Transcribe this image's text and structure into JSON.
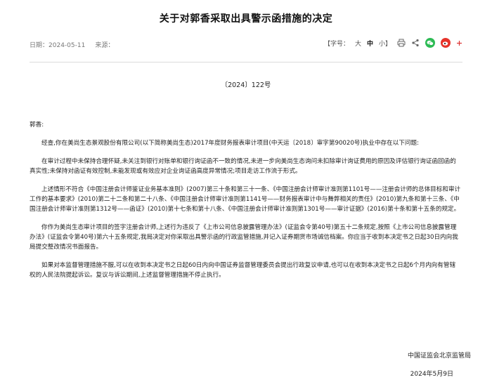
{
  "article": {
    "title": "关于对郭香采取出具警示函措施的决定",
    "date_label": "日期：",
    "date": "2024-05-11",
    "source_label": "来源：",
    "doc_number": "〔2024〕122号",
    "greeting": "郭香:",
    "paragraphs": [
      "经查,你在美尚生态景观股份有限公司(以下简称美尚生态)2017年度财务报表审计项目(中天运〔2018〕审字第90020号)执业中存在以下问题:",
      "在审计过程中未保持合理怀疑,未关注到银行对账单和银行询证函不一致的情况,未进一步向美尚生态询问未扣除审计询证费用的原因及评估银行询证函回函的真实性;未保持对函证有效控制,未能发现或有效应对企业询证函高度异常情况;项目走访工作流于形式。",
      "上述情形不符合《中国注册会计师鉴证业务基本准则》(2007)第三十条和第三十一条、《中国注册会计师审计准则第1101号——注册会计师的总体目标和审计工作的基本要求》(2010)第二十二条和第二十八条、《中国注册会计师审计准则第1141号——财务报表审计中与舞弊相关的责任》(2010)第九条和第十三条、《中国注册会计师审计准则第1312号——函证》(2010)第十七条和第十八条、《中国注册会计师审计准则第1301号——审计证据》(2016)第十条和第十五条的规定。",
      "你作为美尚生态审计项目的签字注册会计师,上述行为违反了《上市公司信息披露管理办法》(证监会令第40号)第五十二条规定,按照《上市公司信息披露管理办法》(证监会令第40号)第六十五条规定,我局决定对你采取出具警示函的行政监管措施,并记入证券期货市场诚信档案。你应当于收到本决定书之日起30日内向我局提交整改情况书面报告。",
      "如果对本监督管理措施不服,可以在收到本决定书之日起60日内向中国证券监督管理委员会提出行政复议申请,也可以在收到本决定书之日起6个月内向有管辖权的人民法院提起诉讼。复议与诉讼期间,上述监督管理措施不停止执行。"
    ],
    "signature": "中国证监会北京监管局",
    "sign_date": "2024年5月9日"
  },
  "toolbar": {
    "font_size_label": "【字号：",
    "size_large": "大",
    "size_medium": "中",
    "size_small": "小】",
    "print_icon": "printer-icon",
    "share_icon": "share-icon",
    "wechat_icon": "wechat-icon",
    "weibo_icon": "weibo-icon",
    "plus_icon": "plus-icon"
  }
}
